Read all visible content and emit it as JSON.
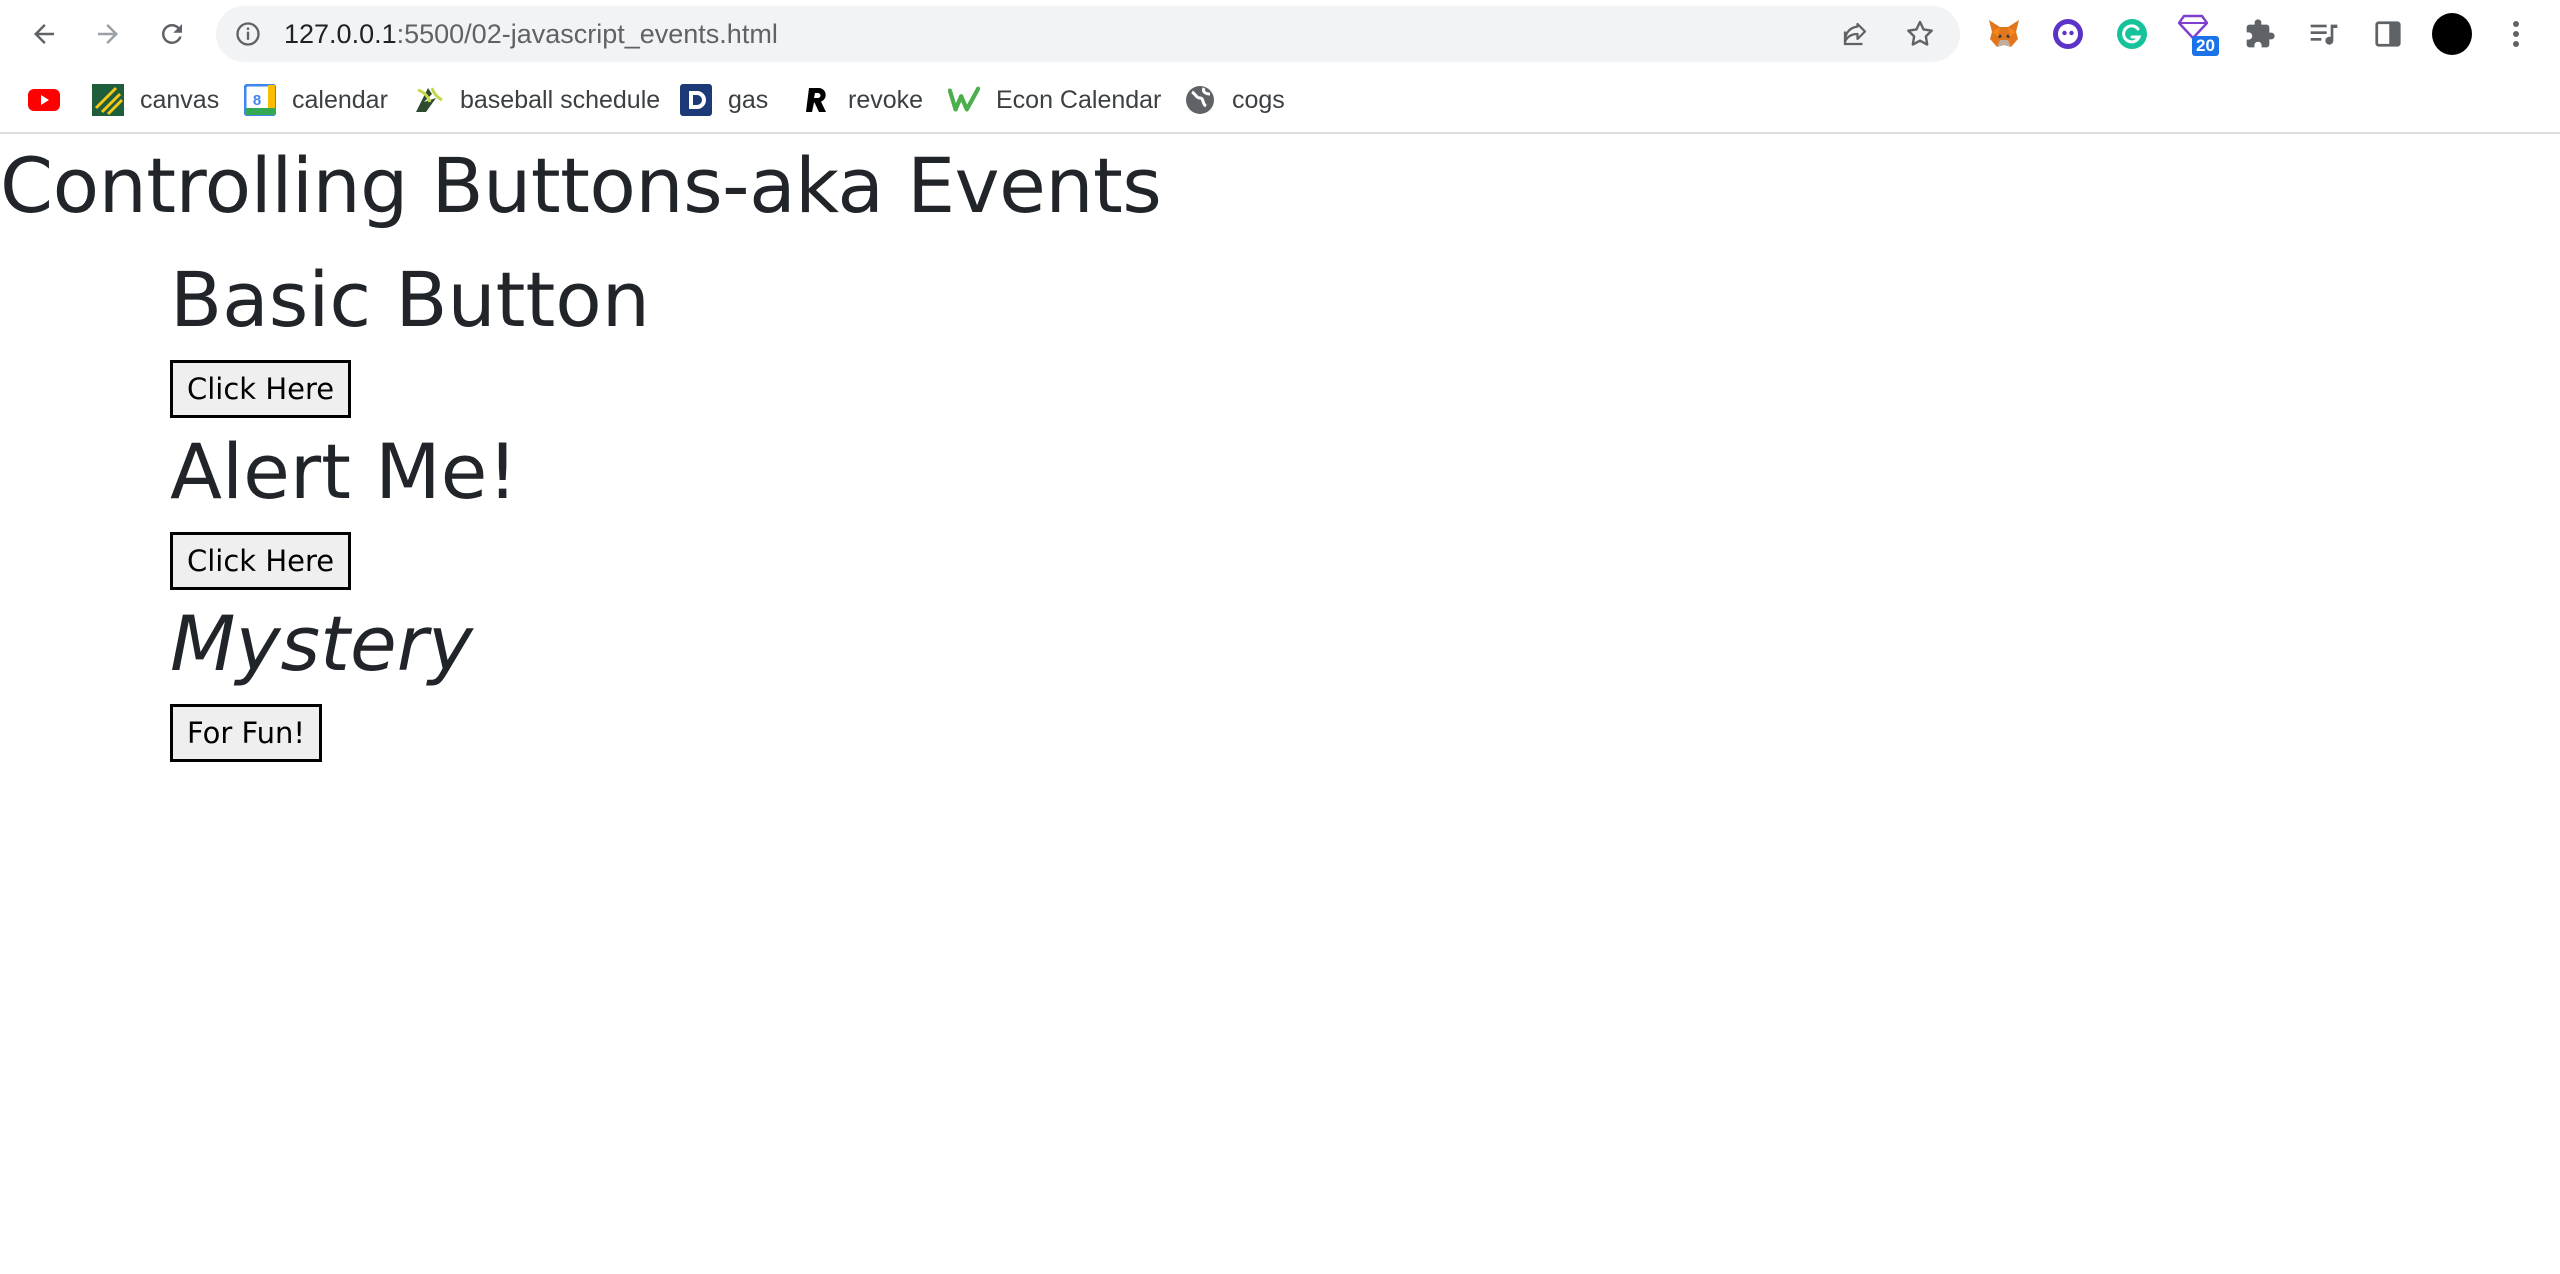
{
  "browser": {
    "url_host": "127.0.0.1",
    "url_rest": ":5500/02-javascript_events.html",
    "extensions_badge": "20"
  },
  "bookmarks": [
    {
      "label": "",
      "icon": "youtube-icon"
    },
    {
      "label": "canvas",
      "icon": "canvas-icon"
    },
    {
      "label": "calendar",
      "icon": "calendar-icon",
      "icon_text": "8"
    },
    {
      "label": "baseball schedule",
      "icon": "baseball-icon"
    },
    {
      "label": "gas",
      "icon": "gas-icon"
    },
    {
      "label": "revoke",
      "icon": "revoke-icon"
    },
    {
      "label": "Econ Calendar",
      "icon": "econ-calendar-icon"
    },
    {
      "label": "cogs",
      "icon": "globe-icon"
    }
  ],
  "page": {
    "title": "Controlling Buttons-aka Events",
    "sections": [
      {
        "heading": "Basic Button",
        "button_label": "Click Here"
      },
      {
        "heading": "Alert Me!",
        "button_label": "Click Here"
      },
      {
        "heading": "Mystery",
        "button_label": "For Fun!"
      }
    ]
  },
  "colors": {
    "accent": "#1a73e8",
    "text": "#212529",
    "omnibox_bg": "#f1f3f4"
  }
}
